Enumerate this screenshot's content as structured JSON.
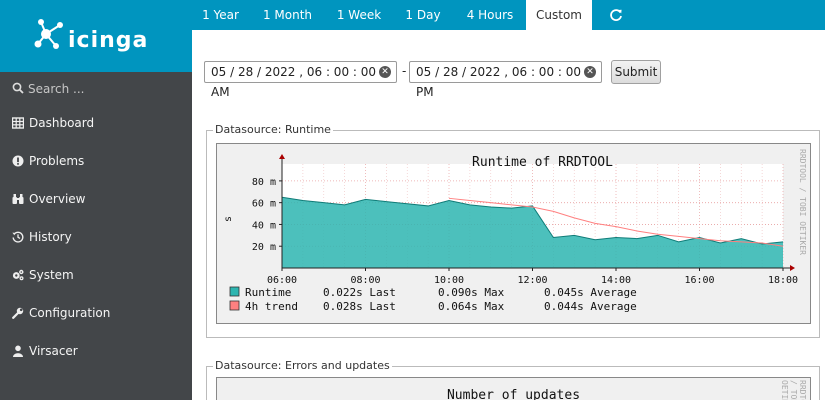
{
  "brand": {
    "name": "icinga"
  },
  "search": {
    "placeholder": "Search ..."
  },
  "sidebar": {
    "items": [
      {
        "label": "Dashboard",
        "icon": "dashboard-icon"
      },
      {
        "label": "Problems",
        "icon": "problems-icon"
      },
      {
        "label": "Overview",
        "icon": "overview-icon"
      },
      {
        "label": "History",
        "icon": "history-icon"
      },
      {
        "label": "System",
        "icon": "system-icon"
      },
      {
        "label": "Configuration",
        "icon": "configuration-icon"
      },
      {
        "label": "Virsacer",
        "icon": "user-icon"
      }
    ]
  },
  "tabs": [
    {
      "label": "1 Year"
    },
    {
      "label": "1 Month"
    },
    {
      "label": "1 Week"
    },
    {
      "label": "1 Day"
    },
    {
      "label": "4 Hours"
    },
    {
      "label": "Custom",
      "active": true
    }
  ],
  "range": {
    "start": "05 / 28 / 2022 ,  06 : 00 : 00   AM",
    "end": "05 / 28 / 2022 ,  06 : 00 : 00   PM",
    "separator": "-",
    "submit": "Submit"
  },
  "datasources": [
    {
      "legend": "Datasource: Runtime"
    },
    {
      "legend": "Datasource: Errors and updates"
    }
  ],
  "graph2": {
    "title": "Number of updates"
  },
  "colors": {
    "brand": "#0095bf",
    "sidebar": "#434649",
    "runtime": "#2db5b0",
    "trend": "#ff8080"
  },
  "chart_data": {
    "type": "area",
    "title": "Runtime of RRDTOOL",
    "ylabel": "s",
    "watermark": "RRDTOOL / TOBI OETIKER",
    "x_ticks": [
      "06:00",
      "08:00",
      "10:00",
      "12:00",
      "14:00",
      "16:00",
      "18:00"
    ],
    "y_ticks": [
      "20 m",
      "40 m",
      "60 m",
      "80 m"
    ],
    "ylim": [
      0,
      90
    ],
    "x": [
      "06:00",
      "06:30",
      "07:00",
      "07:30",
      "08:00",
      "08:30",
      "09:00",
      "09:30",
      "10:00",
      "10:30",
      "11:00",
      "11:30",
      "12:00",
      "12:30",
      "13:00",
      "13:30",
      "14:00",
      "14:30",
      "15:00",
      "15:30",
      "16:00",
      "16:30",
      "17:00",
      "17:30",
      "18:00"
    ],
    "series": [
      {
        "name": "Runtime",
        "color": "#2db5b0",
        "values": [
          65,
          62,
          60,
          58,
          63,
          61,
          59,
          57,
          62,
          58,
          56,
          55,
          57,
          28,
          30,
          26,
          28,
          27,
          30,
          24,
          28,
          23,
          27,
          22,
          24
        ]
      },
      {
        "name": "4h trend",
        "color": "#ff8080",
        "values": [
          null,
          null,
          null,
          null,
          null,
          null,
          null,
          null,
          64,
          62,
          60,
          58,
          56,
          52,
          46,
          41,
          38,
          34,
          31,
          29,
          27,
          25,
          24,
          23,
          20
        ]
      }
    ],
    "legend": [
      {
        "name": "Runtime",
        "last": "0.022s Last",
        "max": "0.090s Max",
        "avg": "0.045s Average"
      },
      {
        "name": "4h trend",
        "last": "0.028s Last",
        "max": "0.064s Max",
        "avg": "0.044s Average"
      }
    ]
  }
}
